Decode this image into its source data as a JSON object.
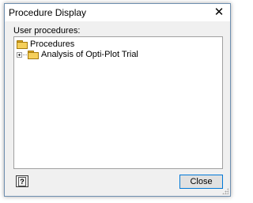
{
  "window": {
    "title": "Procedure Display",
    "close_glyph": "✕"
  },
  "tree": {
    "label": "User procedures:",
    "root": {
      "label": "Procedures",
      "icon": "folder-open-icon"
    },
    "children": [
      {
        "label": "Analysis of Opti-Plot Trial",
        "icon": "folder-icon",
        "expander": "plus"
      }
    ]
  },
  "buttons": {
    "help_label": "?",
    "close_label": "Close"
  },
  "colors": {
    "accent": "#0078d7",
    "folder": "#f5cf5a"
  }
}
